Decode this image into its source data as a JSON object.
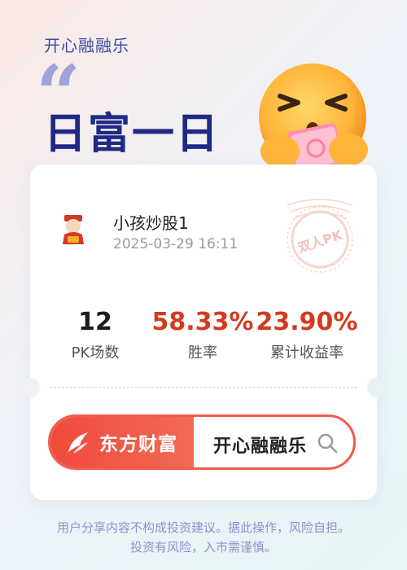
{
  "header": {
    "app_name": "开心融融乐",
    "quote_mark": "“",
    "headline": "日富一日"
  },
  "profile": {
    "username": "小孩炒股1",
    "datetime": "2025-03-29 16:11",
    "stamp_text": "双人PK"
  },
  "stats": [
    {
      "value": "12",
      "label": "PK场数"
    },
    {
      "value": "58.33%",
      "label": "胜率"
    },
    {
      "value": "23.90%",
      "label": "累计收益率"
    }
  ],
  "brand": {
    "name": "东方财富",
    "search_text": "开心融融乐"
  },
  "disclaimer": {
    "line1": "用户分享内容不构成投资建议。据此操作，风险自担。",
    "line2": "投资有风险，入市需谨慎。"
  },
  "colors": {
    "accent_red": "#d33a1f",
    "brand_red": "#ef4a3c",
    "title_blue": "#1f2a86"
  }
}
